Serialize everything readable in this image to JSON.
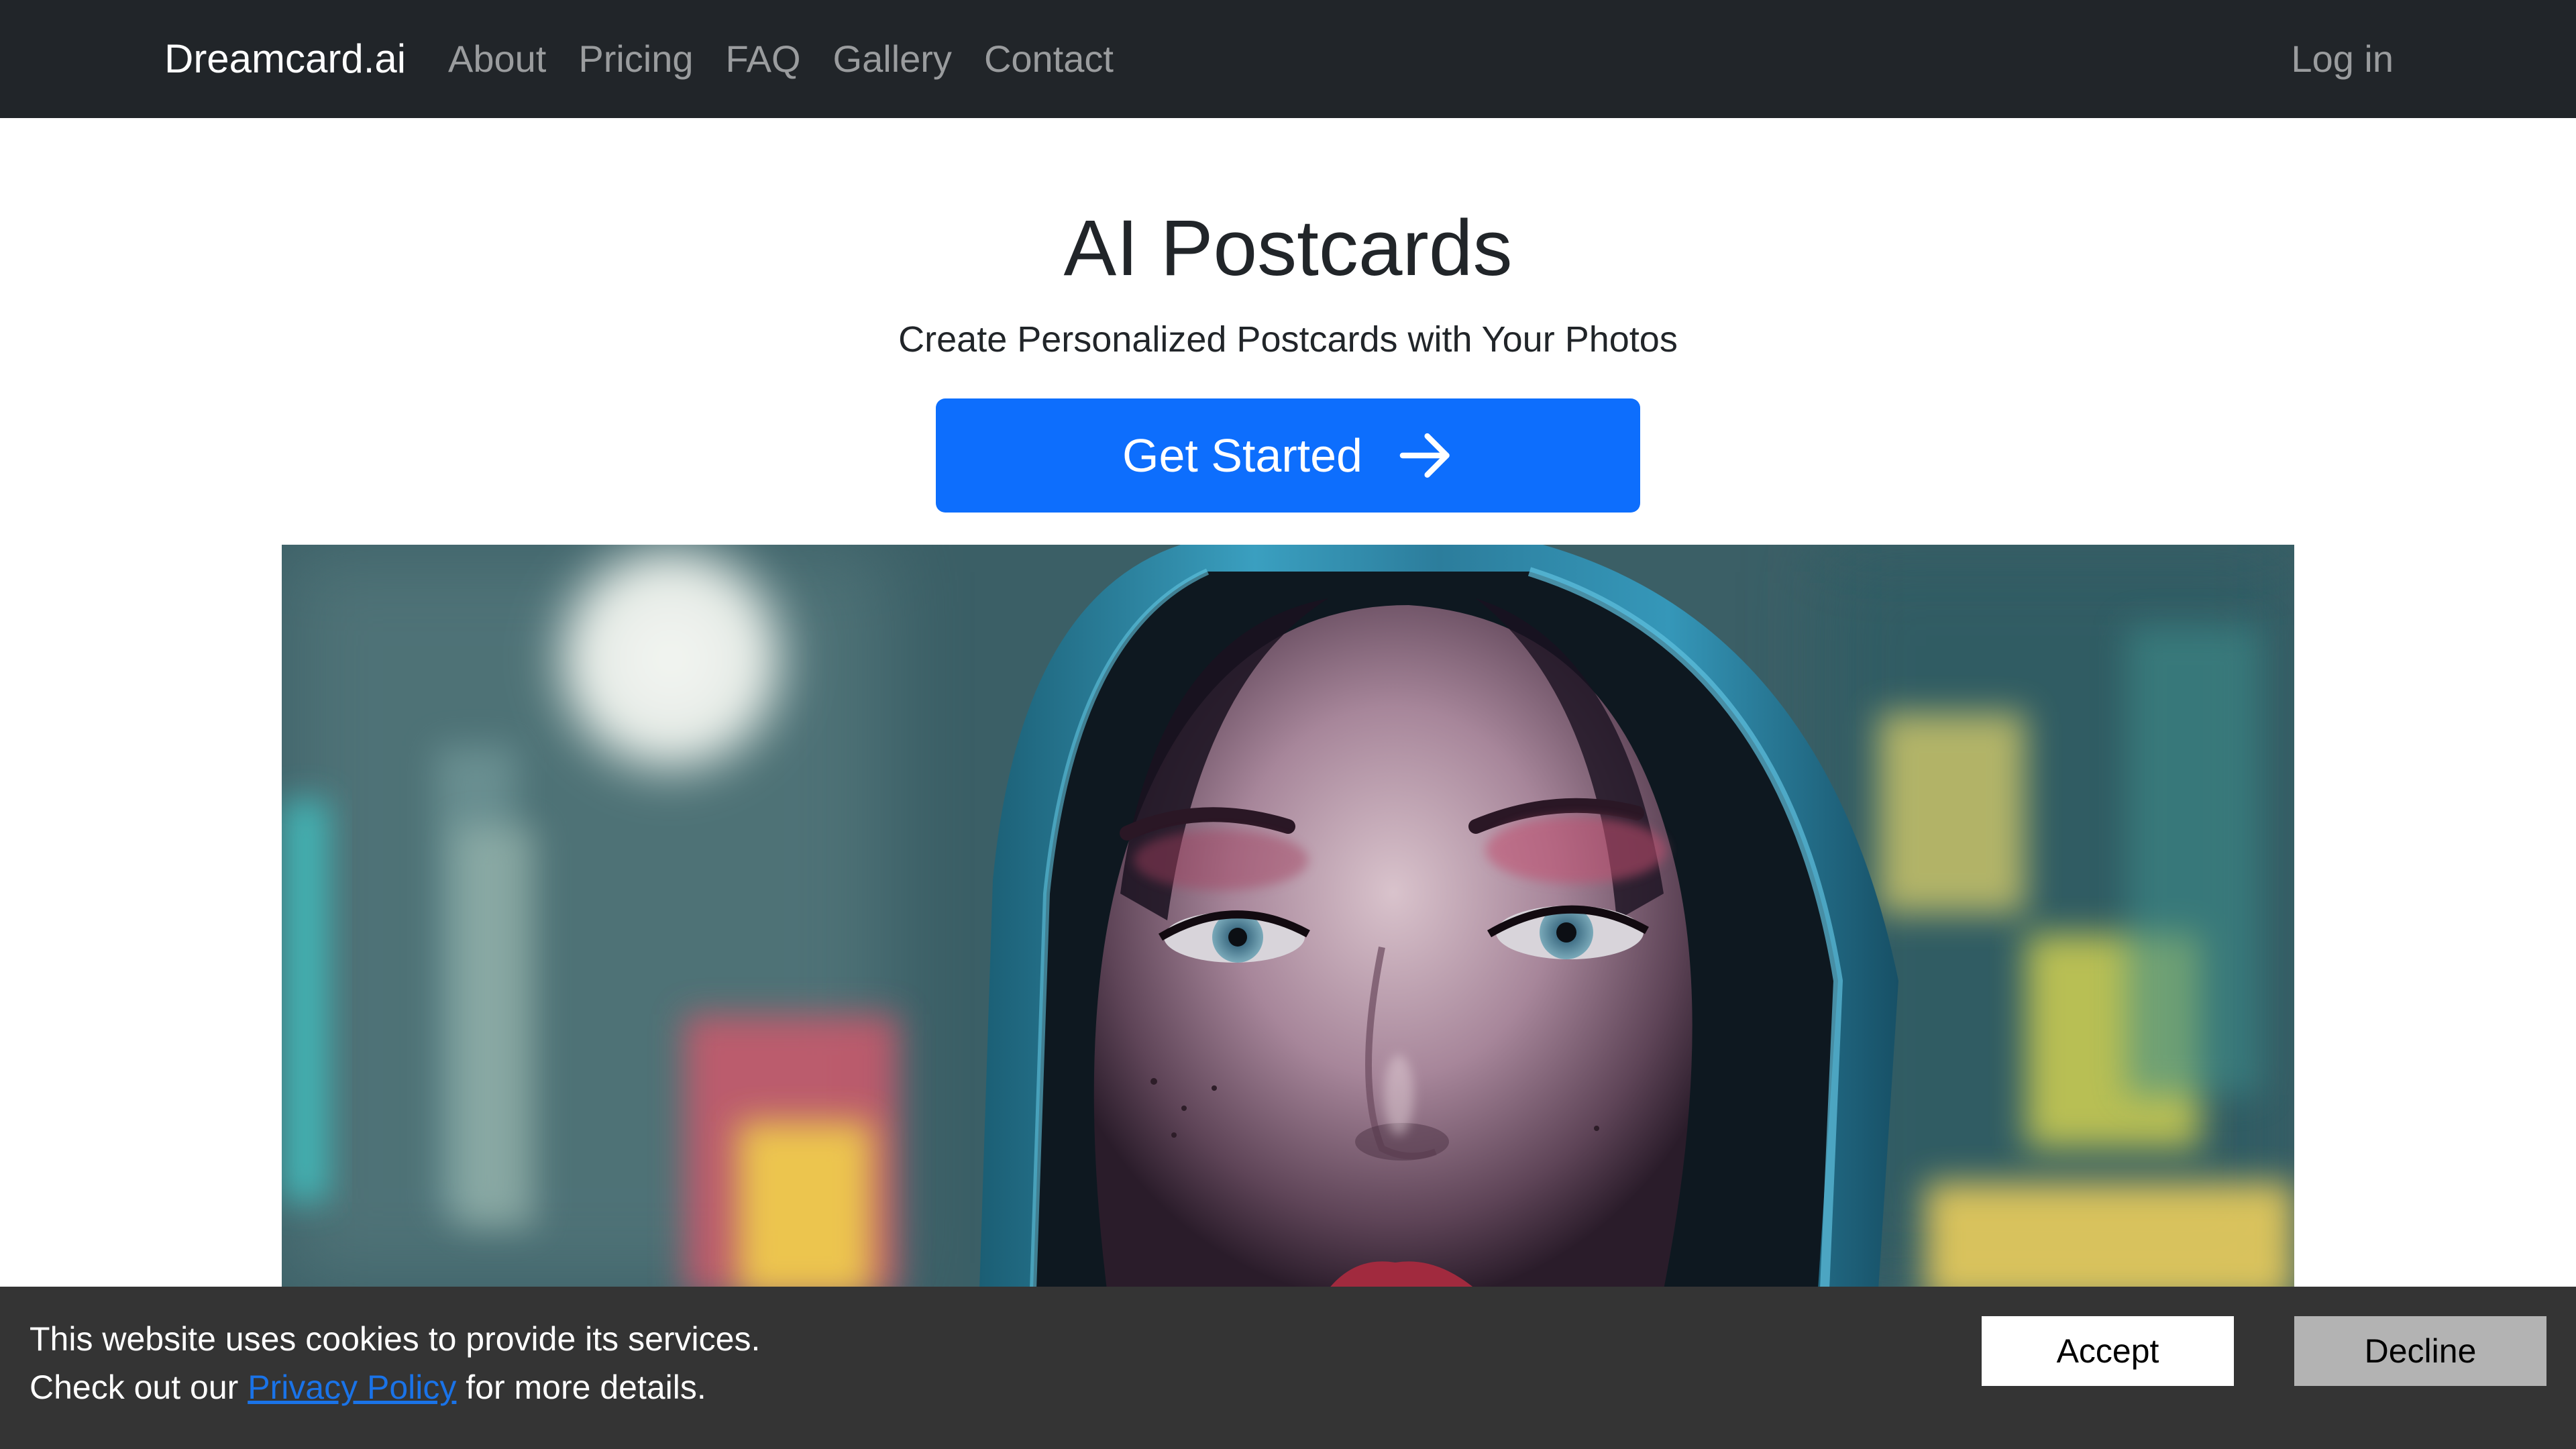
{
  "navbar": {
    "brand": "Dreamcard.ai",
    "links": [
      {
        "label": "About"
      },
      {
        "label": "Pricing"
      },
      {
        "label": "FAQ"
      },
      {
        "label": "Gallery"
      },
      {
        "label": "Contact"
      }
    ],
    "login_label": "Log in"
  },
  "hero": {
    "title": "AI Postcards",
    "subtitle": "Create Personalized Postcards with Your Photos",
    "cta_label": "Get Started",
    "cta_icon": "arrow-right-icon",
    "image_alt": "AI generated portrait of a woman in a teal hood against blurred neon city lights"
  },
  "cookie_banner": {
    "line1": "This website uses cookies to provide its services.",
    "line2_prefix": "Check out our",
    "privacy_link": "Privacy Policy",
    "line2_suffix": "for more details.",
    "accept_label": "Accept",
    "decline_label": "Decline"
  },
  "colors": {
    "navbar_bg": "#212529",
    "primary": "#0d6efd",
    "cookie_bg": "#343434",
    "link": "#1a73e8"
  }
}
